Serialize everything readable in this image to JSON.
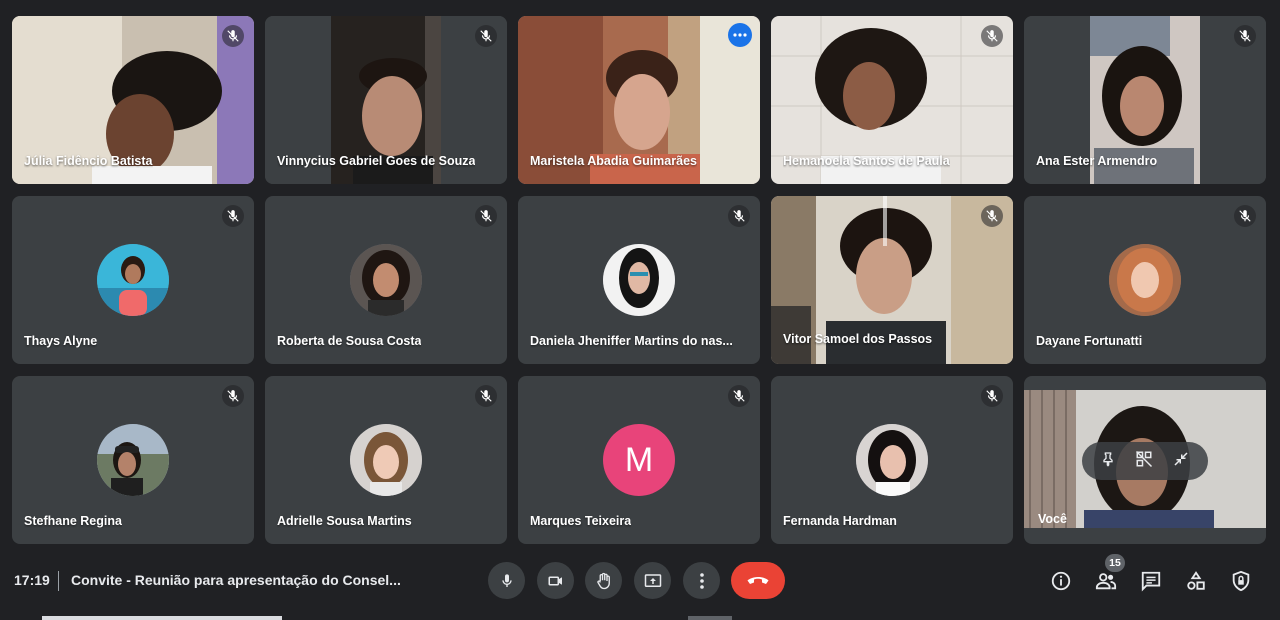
{
  "participants": [
    {
      "name": "Júlia Fidêncio Batista"
    },
    {
      "name": "Vinnycius Gabriel Goes de Souza"
    },
    {
      "name": "Maristela Abadia Guimarães"
    },
    {
      "name": "Hemanoela Santos de Paula"
    },
    {
      "name": "Ana Ester Armendro"
    },
    {
      "name": "Thays Alyne"
    },
    {
      "name": "Roberta de Sousa Costa"
    },
    {
      "name": "Daniela Jheniffer Martins do nas..."
    },
    {
      "name": "Vitor Samoel dos Passos"
    },
    {
      "name": "Dayane Fortunatti"
    },
    {
      "name": "Stefhane Regina"
    },
    {
      "name": "Adrielle Sousa Martins"
    },
    {
      "name": "Marques Teixeira",
      "initial": "M"
    },
    {
      "name": "Fernanda Hardman"
    }
  ],
  "self_view": {
    "name": "Você"
  },
  "bottom_bar": {
    "time": "17:19",
    "meeting_title": "Convite - Reunião para apresentação do Consel...",
    "people_count": "15"
  },
  "colors": {
    "background": "#202124",
    "tile": "#3c4043",
    "accent": "#8ab4f8",
    "hangup": "#ea4335",
    "avatar_letter_bg": "#e8447a"
  },
  "icons": [
    "mic-off-icon",
    "more-options-icon",
    "mic-icon",
    "camera-icon",
    "raise-hand-icon",
    "present-screen-icon",
    "more-vert-icon",
    "hang-up-icon",
    "info-icon",
    "people-icon",
    "chat-icon",
    "activities-icon",
    "host-controls-icon",
    "pin-icon",
    "remove-from-grid-icon",
    "minimize-icon"
  ]
}
